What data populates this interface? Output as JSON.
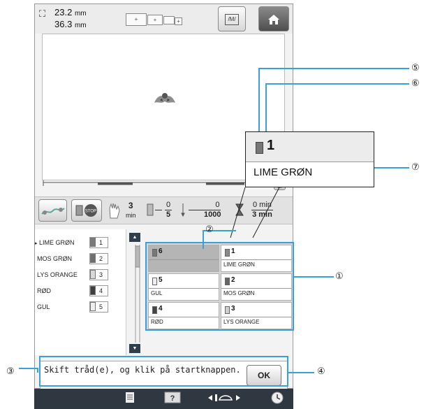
{
  "dimensions": {
    "width": "23.2",
    "height": "36.3",
    "unit": "mm"
  },
  "toolbar": {
    "frame_icons": [
      "+",
      "+",
      "+"
    ],
    "memory_icon": "memory-icon",
    "home_icon": "home-icon"
  },
  "control_bar": {
    "time_top": "3",
    "time_bottom": "min",
    "color_fraction": {
      "num": "0",
      "den": "5"
    },
    "stitch_fraction": {
      "num": "0",
      "den": "1000"
    },
    "total_fraction": {
      "num": "0 min",
      "den": "3 min"
    }
  },
  "color_list": [
    {
      "name": "LIME GRØN",
      "no": "1",
      "color": "#7a7a7a",
      "current": true
    },
    {
      "name": "MOS GRØN",
      "no": "2",
      "color": "#6e6e6e"
    },
    {
      "name": "LYS ORANGE",
      "no": "3",
      "color": "#d8d8d8"
    },
    {
      "name": "RØD",
      "no": "4",
      "color": "#3e3e3e"
    },
    {
      "name": "GUL",
      "no": "5",
      "color": "#f0f0f0"
    }
  ],
  "needle_grid": [
    {
      "no": "6",
      "name": "",
      "color": "#777",
      "selected": true
    },
    {
      "no": "1",
      "name": "LIME GRØN",
      "color": "#8a8a8a"
    },
    {
      "no": "5",
      "name": "GUL",
      "color": "#efefef"
    },
    {
      "no": "2",
      "name": "MOS GRØN",
      "color": "#666"
    },
    {
      "no": "4",
      "name": "RØD",
      "color": "#444"
    },
    {
      "no": "3",
      "name": "LYS ORANGE",
      "color": "#cfcfcf"
    }
  ],
  "message": {
    "text": "Skift tråd(e), og klik på startknappen.",
    "ok_label": "OK"
  },
  "zoom": {
    "needle_no": "1",
    "color_name": "LIME GRØN"
  },
  "callouts": [
    "①",
    "②",
    "③",
    "④",
    "⑤",
    "⑥",
    "⑦"
  ],
  "bottom_icons": [
    "page-icon",
    "help-icon",
    "frame-move-icon",
    "clock-icon"
  ],
  "accent_color": "#3aa0da"
}
